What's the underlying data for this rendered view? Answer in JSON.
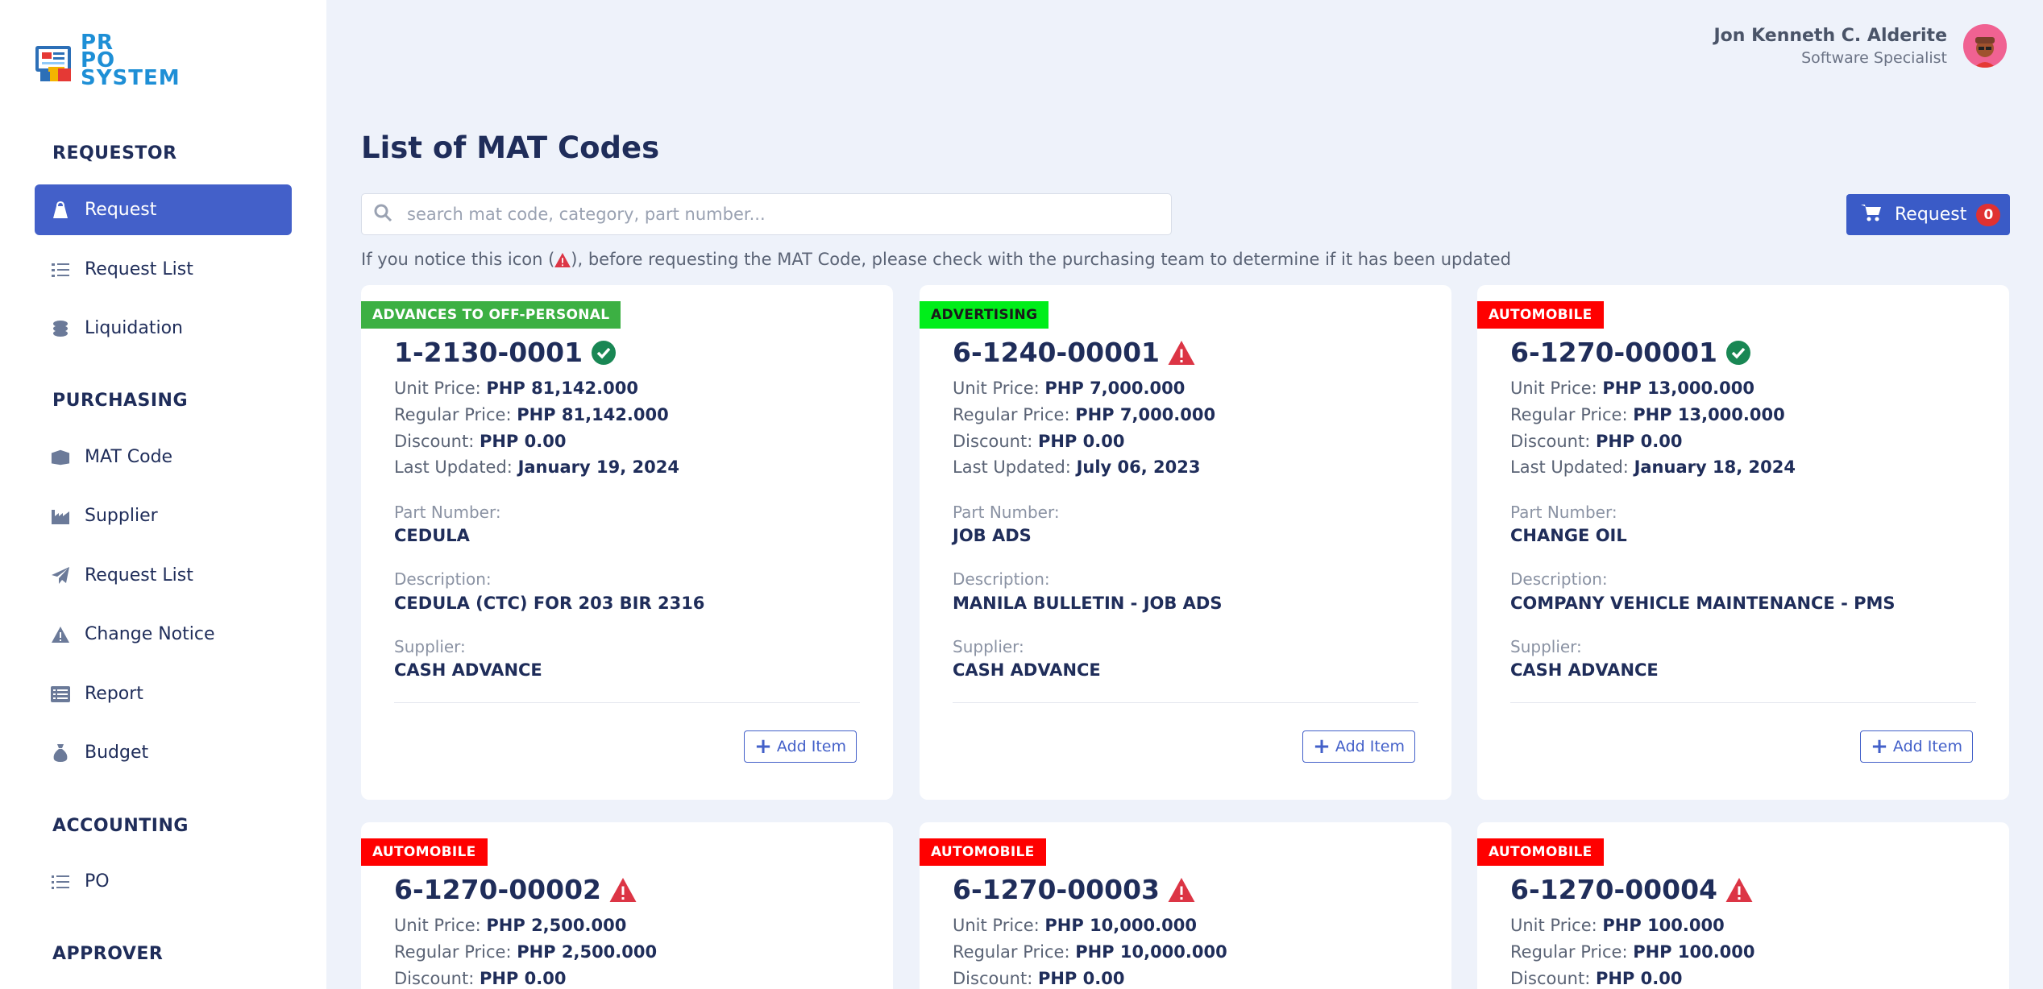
{
  "logo": {
    "line1": "PR",
    "line2": "PO",
    "line3": "SYSTEM"
  },
  "user": {
    "name": "Jon Kenneth C. Alderite",
    "role": "Software Specialist"
  },
  "sidebar": {
    "sections": [
      {
        "title": "REQUESTOR"
      },
      {
        "title": "PURCHASING"
      },
      {
        "title": "ACCOUNTING"
      },
      {
        "title": "APPROVER"
      }
    ],
    "items": [
      {
        "label": "Request",
        "icon": "bag-icon",
        "active": true
      },
      {
        "label": "Request List",
        "icon": "list-check-icon"
      },
      {
        "label": "Liquidation",
        "icon": "coins-icon"
      },
      {
        "label": "MAT Code",
        "icon": "box-icon"
      },
      {
        "label": "Supplier",
        "icon": "factory-icon"
      },
      {
        "label": "Request List",
        "icon": "paper-plane-icon"
      },
      {
        "label": "Change Notice",
        "icon": "warning-icon"
      },
      {
        "label": "Report",
        "icon": "list-alt-icon"
      },
      {
        "label": "Budget",
        "icon": "money-bag-icon"
      },
      {
        "label": "PO",
        "icon": "list-icon"
      }
    ]
  },
  "main": {
    "title": "List of MAT Codes",
    "search_placeholder": "search mat code, category, part number...",
    "request_button": {
      "label": "Request",
      "count": "0"
    },
    "notice_before": "If you notice this icon (",
    "notice_after": "), before requesting the MAT Code, please check with the purchasing team to determine if it has been updated",
    "labels": {
      "unit_price": "Unit Price: ",
      "regular_price": "Regular Price: ",
      "discount": "Discount: ",
      "last_updated": "Last Updated: ",
      "part_number": "Part Number:",
      "description": "Description:",
      "supplier": "Supplier:",
      "add_item": "Add Item"
    },
    "cards": [
      {
        "category": "ADVANCES TO OFF-PERSONAL",
        "tag_color": "#3cb043",
        "code": "1-2130-0001",
        "status": "verified",
        "unit_price": "PHP 81,142.000",
        "regular_price": "PHP 81,142.000",
        "discount": "PHP 0.00",
        "last_updated": "January 19, 2024",
        "part_number": "CEDULA",
        "description": "CEDULA (CTC) FOR 203 BIR 2316",
        "supplier": "CASH ADVANCE"
      },
      {
        "category": "ADVERTISING",
        "tag_color": "#00ee1a",
        "code": "6-1240-00001",
        "status": "warning",
        "unit_price": "PHP 7,000.000",
        "regular_price": "PHP 7,000.000",
        "discount": "PHP 0.00",
        "last_updated": "July 06, 2023",
        "part_number": "JOB ADS",
        "description": "MANILA BULLETIN - JOB ADS",
        "supplier": "CASH ADVANCE"
      },
      {
        "category": "AUTOMOBILE",
        "tag_color": "#ff0000",
        "code": "6-1270-00001",
        "status": "verified",
        "unit_price": "PHP 13,000.000",
        "regular_price": "PHP 13,000.000",
        "discount": "PHP 0.00",
        "last_updated": "January 18, 2024",
        "part_number": "CHANGE OIL",
        "description": "COMPANY VEHICLE MAINTENANCE - PMS",
        "supplier": "CASH ADVANCE"
      },
      {
        "category": "AUTOMOBILE",
        "tag_color": "#ff0000",
        "code": "6-1270-00002",
        "status": "warning",
        "unit_price": "PHP 2,500.000",
        "regular_price": "PHP 2,500.000",
        "discount": "PHP 0.00"
      },
      {
        "category": "AUTOMOBILE",
        "tag_color": "#ff0000",
        "code": "6-1270-00003",
        "status": "warning",
        "unit_price": "PHP 10,000.000",
        "regular_price": "PHP 10,000.000",
        "discount": "PHP 0.00"
      },
      {
        "category": "AUTOMOBILE",
        "tag_color": "#ff0000",
        "code": "6-1270-00004",
        "status": "warning",
        "unit_price": "PHP 100.000",
        "regular_price": "PHP 100.000",
        "discount": "PHP 0.00"
      }
    ]
  }
}
